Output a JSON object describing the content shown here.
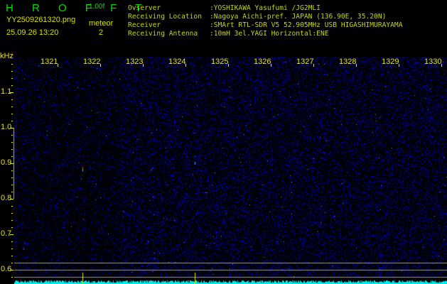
{
  "header": {
    "app_name": "HROFFT",
    "app_letters": "H R O F F T",
    "version": "1.00f",
    "filename": "YY2509261320.png",
    "datetime": "25.09.26 13:20",
    "meteor_label": "meteor",
    "meteor_count": "2"
  },
  "info": [
    {
      "label": "Ovserver",
      "value": ":YOSHIKAWA Yasufumi /JG2MLI"
    },
    {
      "label": "Receiving Location",
      "value": ":Nagoya Aichi-pref. JAPAN (136.90E, 35.20N)"
    },
    {
      "label": "Receiver",
      "value": ":SMArt RTL-SDR V5 52.905MHz USB HIGASHIMURAYAMA"
    },
    {
      "label": "Receiving Antenna",
      "value": ":10mH 3el.YAGI Horizontal:ENE"
    }
  ],
  "axis": {
    "y_unit": "kHz",
    "x_ticks": [
      "1321",
      "1322",
      "1323",
      "1324",
      "1325",
      "1326",
      "1327",
      "1328",
      "1329",
      "1330"
    ],
    "y_ticks": [
      "1.1",
      "1.0",
      "0.9",
      "0.8",
      "0.7",
      "0.6"
    ]
  },
  "colors": {
    "background": "#000000",
    "noise": "#1010c0",
    "text": "#e8e800",
    "title": "#00e000",
    "spectrum": "#00e8e8"
  }
}
